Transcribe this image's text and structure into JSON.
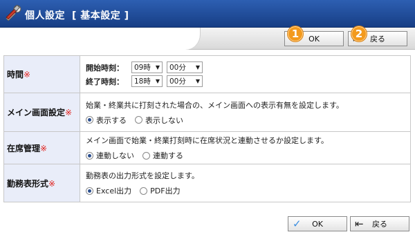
{
  "header": {
    "title": "個人設定",
    "subtitle": "[ 基本設定 ]",
    "icon": "tools-icon"
  },
  "toolbar": {
    "ok_label": "OK",
    "back_label": "戻る",
    "ok_badge": "1",
    "back_badge": "2"
  },
  "rows": {
    "time": {
      "label": "時間",
      "required_mark": "※",
      "start_label": "開始時刻：",
      "start_hour": "09時",
      "start_min": "00分",
      "end_label": "終了時刻：",
      "end_hour": "18時",
      "end_min": "00分"
    },
    "main_screen": {
      "label": "メイン画面設定",
      "required_mark": "※",
      "description": "始業・終業共に打刻された場合の、メイン画面への表示有無を設定します。",
      "options": [
        "表示する",
        "表示しない"
      ],
      "selected": 0
    },
    "presence": {
      "label": "在席管理",
      "required_mark": "※",
      "description": "メイン画面で始業・終業打刻時に在席状況と連動させるか設定します。",
      "options": [
        "連動しない",
        "連動する"
      ],
      "selected": 0
    },
    "output_format": {
      "label": "勤務表形式",
      "required_mark": "※",
      "description": "勤務表の出力形式を設定します。",
      "options": [
        "Excel出力",
        "PDF出力"
      ],
      "selected": 0
    }
  },
  "footer": {
    "ok_label": "OK",
    "back_label": "戻る"
  },
  "colors": {
    "title_bar": "#1f4a96",
    "label_cell": "#e9edf9",
    "required": "#e0201b",
    "badge": "#f39a1d"
  }
}
